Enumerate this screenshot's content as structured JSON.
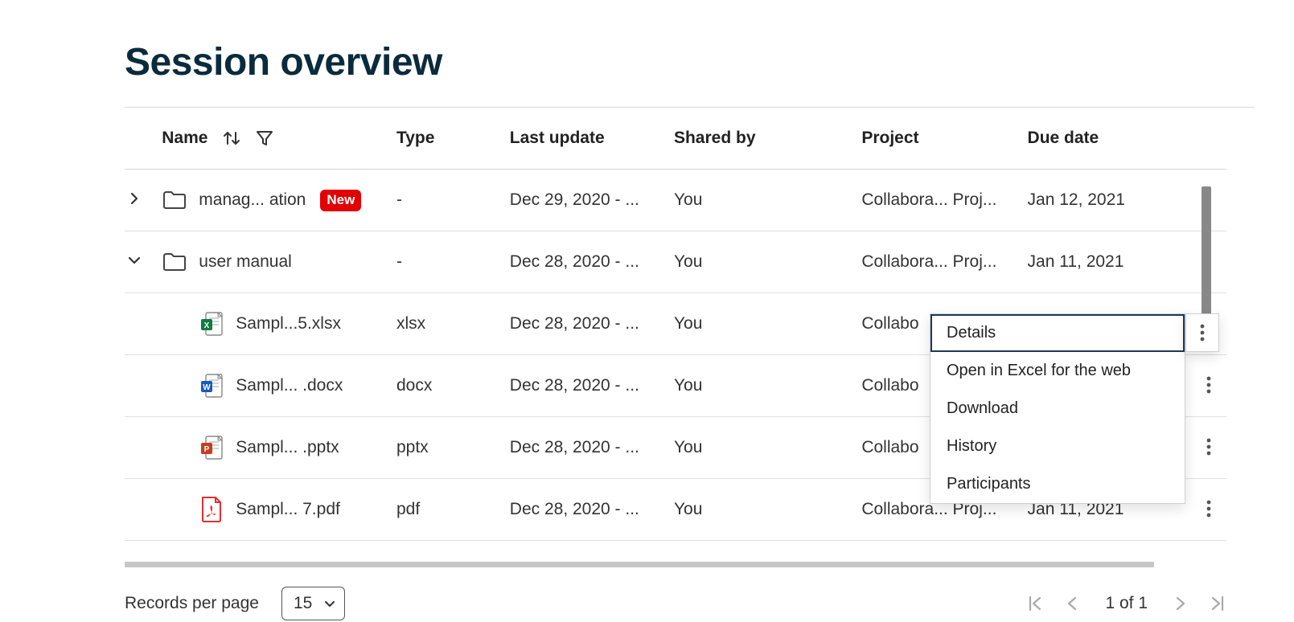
{
  "page": {
    "title": "Session overview"
  },
  "columns": {
    "name": "Name",
    "type": "Type",
    "last_update": "Last update",
    "shared_by": "Shared by",
    "project": "Project",
    "due_date": "Due date"
  },
  "rows": [
    {
      "kind": "folder",
      "expand": "right",
      "name": "manag... ation",
      "badge": "New",
      "type": "-",
      "last_update": "Dec 29, 2020 - ...",
      "shared_by": "You",
      "project": "Collabora... Proj...",
      "due_date": "Jan 12, 2021"
    },
    {
      "kind": "folder",
      "expand": "down",
      "name": "user manual",
      "type": "-",
      "last_update": "Dec 28, 2020 - ...",
      "shared_by": "You",
      "project": "Collabora... Proj...",
      "due_date": "Jan 11, 2021"
    },
    {
      "kind": "xlsx",
      "indent": true,
      "name": "Sampl...5.xlsx",
      "type": "xlsx",
      "last_update": "Dec 28, 2020 - ...",
      "shared_by": "You",
      "project": "Collabo",
      "due_date": ""
    },
    {
      "kind": "docx",
      "indent": true,
      "name": "Sampl... .docx",
      "type": "docx",
      "last_update": "Dec 28, 2020 - ...",
      "shared_by": "You",
      "project": "Collabo",
      "due_date": ""
    },
    {
      "kind": "pptx",
      "indent": true,
      "name": "Sampl... .pptx",
      "type": "pptx",
      "last_update": "Dec 28, 2020 - ...",
      "shared_by": "You",
      "project": "Collabo",
      "due_date": ""
    },
    {
      "kind": "pdf",
      "indent": true,
      "name": "Sampl... 7.pdf",
      "type": "pdf",
      "last_update": "Dec 28, 2020 - ...",
      "shared_by": "You",
      "project": "Collabora... Proj...",
      "due_date": "Jan 11, 2021"
    }
  ],
  "context_menu": {
    "items": [
      "Details",
      "Open in Excel for the web",
      "Download",
      "History",
      "Participants"
    ],
    "active_index": 0
  },
  "pager": {
    "records_label": "Records per page",
    "page_size": "15",
    "page_label": "1 of 1"
  }
}
